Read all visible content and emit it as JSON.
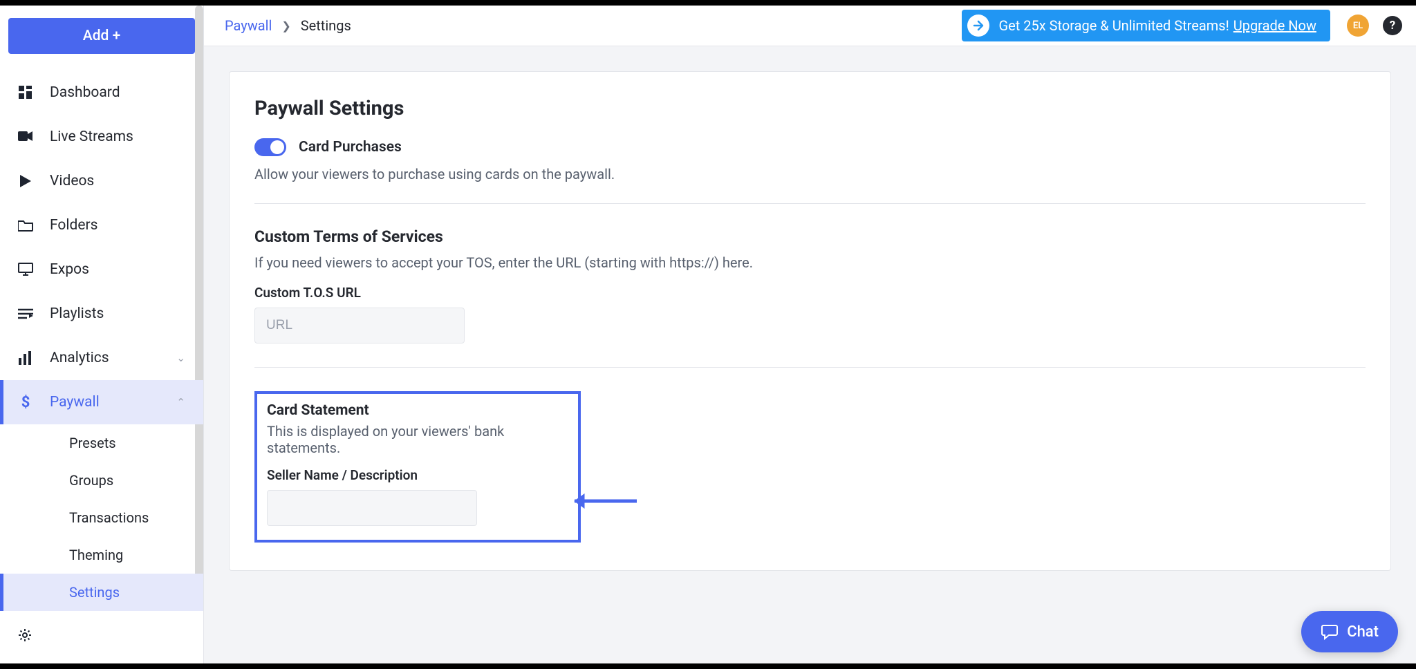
{
  "sidebar": {
    "add_label": "Add +",
    "items": [
      {
        "label": "Dashboard"
      },
      {
        "label": "Live Streams"
      },
      {
        "label": "Videos"
      },
      {
        "label": "Folders"
      },
      {
        "label": "Expos"
      },
      {
        "label": "Playlists"
      },
      {
        "label": "Analytics",
        "expandable": true
      },
      {
        "label": "Paywall",
        "expandable": true,
        "active": true
      }
    ],
    "paywall_sub": [
      {
        "label": "Presets"
      },
      {
        "label": "Groups"
      },
      {
        "label": "Transactions"
      },
      {
        "label": "Theming"
      },
      {
        "label": "Settings",
        "active": true
      }
    ]
  },
  "breadcrumb": {
    "parent": "Paywall",
    "current": "Settings"
  },
  "upgrade": {
    "text": "Get 25x Storage & Unlimited Streams!",
    "cta": "Upgrade Now"
  },
  "avatar": "EL",
  "page": {
    "title": "Paywall Settings",
    "card_purchases": {
      "label": "Card Purchases",
      "desc": "Allow your viewers to purchase using cards on the paywall."
    },
    "tos": {
      "title": "Custom Terms of Services",
      "desc": "If you need viewers to accept your TOS, enter the URL (starting with https://) here.",
      "field_label": "Custom T.O.S URL",
      "placeholder": "URL"
    },
    "statement": {
      "title": "Card Statement",
      "desc": "This is displayed on your viewers' bank statements.",
      "field_label": "Seller Name / Description"
    }
  },
  "chat": "Chat"
}
